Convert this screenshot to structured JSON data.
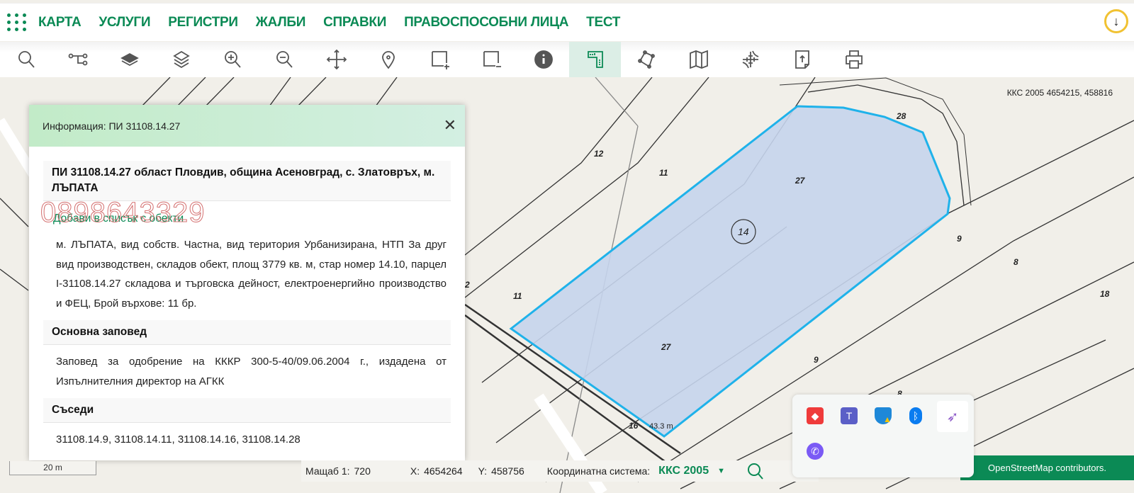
{
  "nav": {
    "items": [
      "КАРТА",
      "УСЛУГИ",
      "РЕГИСТРИ",
      "ЖАЛБИ",
      "СПРАВКИ",
      "ПРАВОСПОСОБНИ ЛИЦА",
      "ТЕСТ"
    ],
    "download_icon": "↓"
  },
  "toolbar": {
    "tools": [
      "search",
      "node-graph",
      "layer-filled",
      "layers",
      "zoom-in",
      "zoom-out",
      "pan",
      "location-pin",
      "select-add",
      "select-remove",
      "info",
      "measure",
      "polygon",
      "map",
      "grid-snap",
      "upload-file",
      "print"
    ],
    "active": "measure"
  },
  "map": {
    "coord_readout": "ККС 2005 4654215, 458816",
    "parcel_number": "14",
    "labels": [
      "12",
      "11",
      "27",
      "28",
      "9",
      "8",
      "18",
      "11",
      "27",
      "9",
      "2",
      "16",
      "8"
    ],
    "measure_label": "43.3 m",
    "parcel_fill": "#c5d4ec",
    "parcel_stroke": "#1fb2ea"
  },
  "panel": {
    "title": "Информация: ПИ 31108.14.27",
    "heading": "ПИ 31108.14.27 област Пловдив, община Асеновград, с. Златовръх, м. ЛЪПАТА",
    "add_link": "Добави в списък с обекти",
    "watermark": "0898643329",
    "description": "м. ЛЪПАТА, вид собств. Частна, вид територия Урбанизирана, НТП За друг вид производствен, складов обект, площ 3779 кв. м, стар номер 14.10, парцел I-31108.14.27 складова и търговска дейност, електроенергийно производство и ФЕЦ, Брой върхове: 11 бр.",
    "order_heading": "Основна заповед",
    "order_text": "Заповед за одобрение на КККР 300-5-40/09.06.2004 г., издадена от Изпълнителния директор на АГКК",
    "neighbors_heading": "Съседи",
    "neighbors_text": "31108.14.9, 31108.14.11, 31108.14.16, 31108.14.28"
  },
  "status": {
    "scale_bar": "20 m",
    "scale_label": "Мащаб 1:",
    "scale_value": "720",
    "x_label": "X:",
    "x_value": "4654264",
    "y_label": "Y:",
    "y_value": "458756",
    "crs_label": "Координатна система:",
    "crs_value": "ККС 2005",
    "attribution": "OpenStreetMap contributors."
  },
  "tray": {
    "icons": [
      "anydesk",
      "teams",
      "defender-warning",
      "bluetooth",
      "feather-app",
      "viber"
    ]
  },
  "colors": {
    "accent": "#0b8a55",
    "header_bg": "#c2ebc8"
  }
}
